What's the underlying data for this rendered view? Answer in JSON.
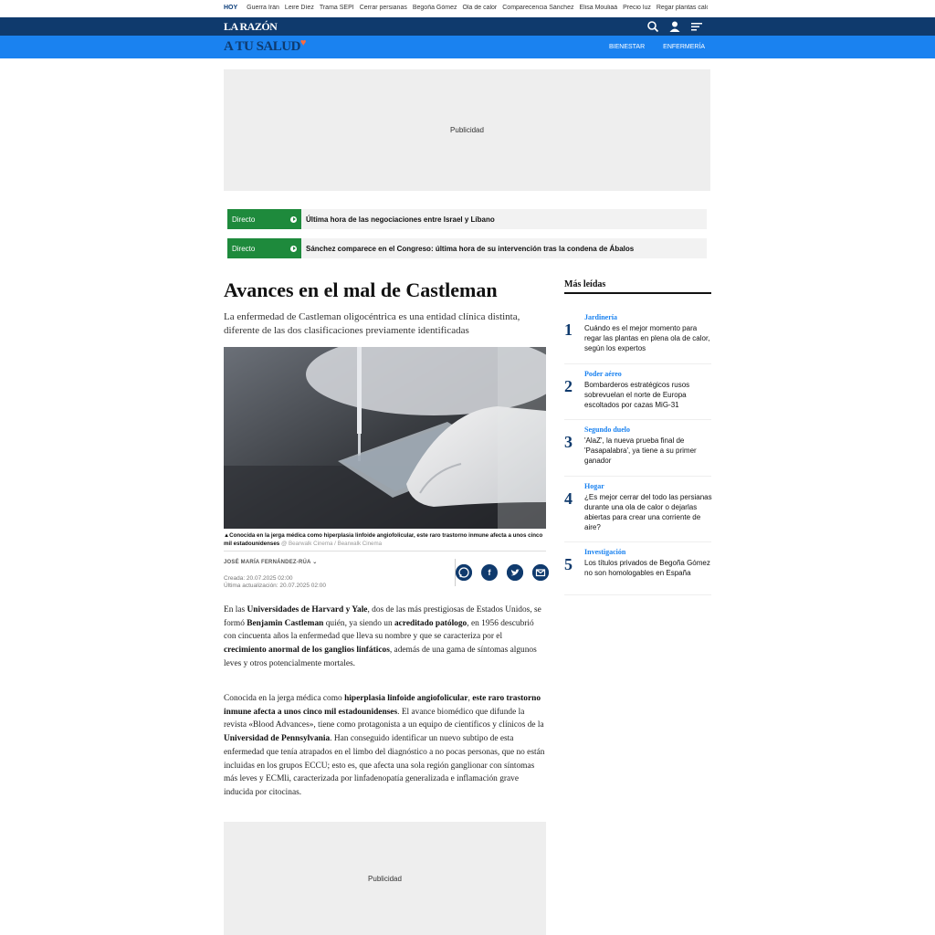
{
  "topbar": {
    "hoy": "HOY",
    "links": [
      "Guerra Irán",
      "Leire Díez",
      "Trama SEPI",
      "Cerrar persianas",
      "Begoña Gómez",
      "Ola de calor",
      "Comparecencia Sánchez",
      "Elisa Mouliaá",
      "Precio luz",
      "Regar plantas calor"
    ]
  },
  "header": {
    "logo": "LA RAZÓN",
    "icons": [
      "search-icon",
      "user-icon",
      "menu-icon"
    ]
  },
  "section": {
    "logo": "A TU SALUD",
    "nav": [
      "BIENESTAR",
      "ENFERMERÍA"
    ]
  },
  "ads": {
    "top": "Publicidad",
    "bottom": "Publicidad"
  },
  "directos": [
    {
      "tag": "Directo",
      "text": "Última hora de las negociaciones entre Israel y Líbano"
    },
    {
      "tag": "Directo",
      "text": "Sánchez comparece en el Congreso: última hora de su intervención tras la condena de Ábalos"
    }
  ],
  "article": {
    "title": "Avances en el mal de Castleman",
    "subtitle": "La enfermedad de Castleman oligocéntrica es una entidad clínica distinta, diferente de las dos clasificaciones previamente identificadas",
    "caption_bold": "Conocida en la jerga médica como hiperplasia linfoide angiofolicular, este raro trastorno inmune afecta a unos cinco mil estadounidenses",
    "caption_credit": "@ Bearwalk Cinema / Bearwalk Cinema",
    "author": "JOSÉ MARÍA FERNÁNDEZ-RÚA",
    "created": "Creada: 20.07.2025 02:00",
    "updated": "Última actualización: 20.07.2025 02:00",
    "share_icons": [
      "whatsapp-icon",
      "facebook-icon",
      "twitter-icon",
      "email-icon"
    ],
    "p1": [
      {
        "t": "En las ",
        "b": false
      },
      {
        "t": "Universidades de Harvard y Yale",
        "b": true
      },
      {
        "t": ", dos de las más prestigiosas de Estados Unidos, se formó ",
        "b": false
      },
      {
        "t": "Benjamin Castleman",
        "b": true
      },
      {
        "t": " quién, ya siendo un ",
        "b": false
      },
      {
        "t": "acreditado patólogo",
        "b": true
      },
      {
        "t": ", en 1956 descubrió con cincuenta años la enfermedad que lleva su nombre y que se caracteriza por el ",
        "b": false
      },
      {
        "t": "crecimiento anormal de los ganglios linfáticos",
        "b": true
      },
      {
        "t": ", además de una gama de síntomas algunos leves y otros potencialmente mortales.",
        "b": false
      }
    ],
    "p2": [
      {
        "t": "Conocida en la jerga médica como ",
        "b": false
      },
      {
        "t": "hiperplasia linfoide angiofolicular",
        "b": true
      },
      {
        "t": ", ",
        "b": false
      },
      {
        "t": "este raro trastorno inmune afecta a unos cinco mil estadounidenses",
        "b": true
      },
      {
        "t": ". El avance biomédico que difunde la revista «Blood Advances», tiene como protagonista a un equipo de científicos y clínicos de la ",
        "b": false
      },
      {
        "t": "Universidad de Pennsylvania",
        "b": true
      },
      {
        "t": ". Han conseguido identificar un nuevo subtipo de esta enfermedad que tenía atrapados en el limbo del diagnóstico a no pocas personas, que no están incluidas en los grupos ECCU; esto es, que afecta una sola región ganglionar con síntomas más leves y ECMli, caracterizada por linfadenopatía generalizada e inflamación grave inducida por citocinas.",
        "b": false
      }
    ]
  },
  "sidebar": {
    "title": "Más leídas",
    "items": [
      {
        "num": "1",
        "cat": "Jardinería",
        "title": "Cuándo es el mejor momento para regar las plantas en plena ola de calor, según los expertos"
      },
      {
        "num": "2",
        "cat": "Poder aéreo",
        "title": "Bombarderos estratégicos rusos sobrevuelan el norte de Europa escoltados por cazas MiG-31"
      },
      {
        "num": "3",
        "cat": "Segundo duelo",
        "title": "'AlaZ', la nueva prueba final de 'Pasapalabra', ya tiene a su primer ganador"
      },
      {
        "num": "4",
        "cat": "Hogar",
        "title": "¿Es mejor cerrar del todo las persianas durante una ola de calor o dejarlas abiertas para crear una corriente de aire?"
      },
      {
        "num": "5",
        "cat": "Investigación",
        "title": "Los títulos privados de Begoña Gómez no son homologables en España"
      }
    ]
  }
}
